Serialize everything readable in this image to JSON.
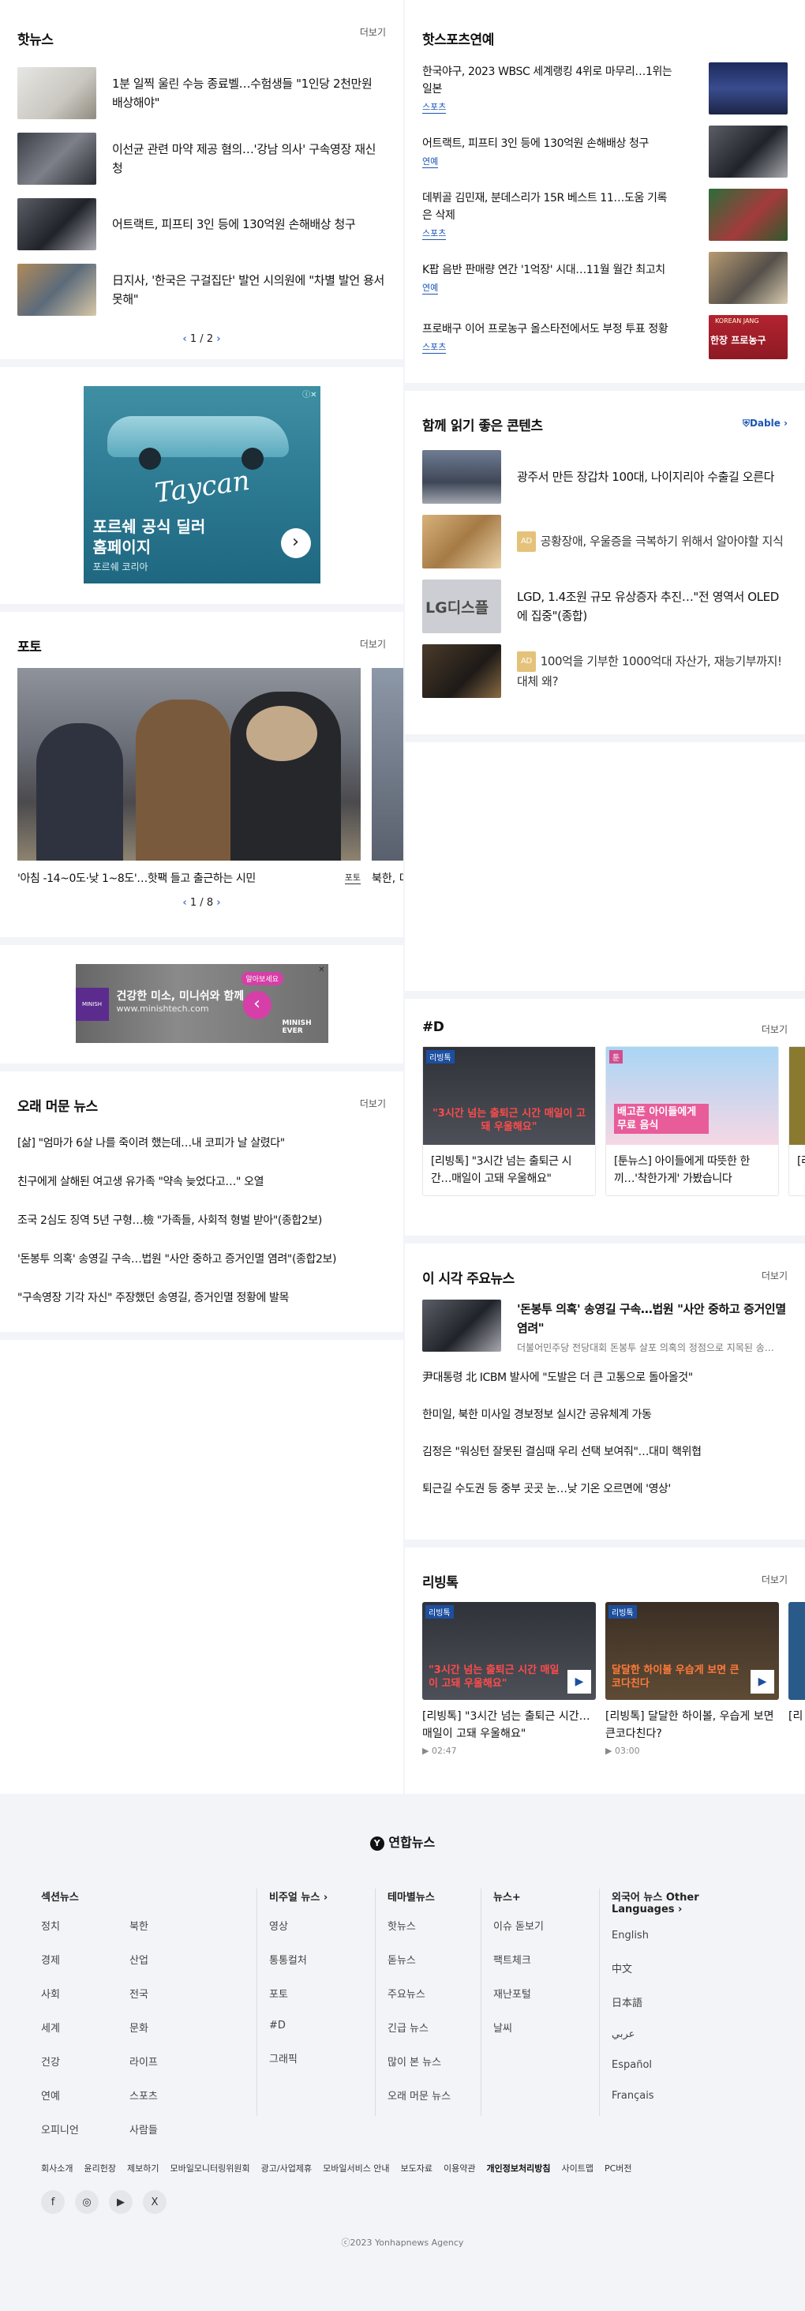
{
  "hot_news": {
    "title": "핫뉴스",
    "more": "더보기",
    "items": [
      "1분 일찍 울린 수능 종료벨…수험생들 \"1인당 2천만원 배상해야\"",
      "이선균 관련 마약 제공 혐의…'강남 의사' 구속영장 재신청",
      "어트랙트, 피프티 3인 등에 130억원 손해배상 청구",
      "日지사, '한국은 구걸집단' 발언 시의원에 \"차별 발언 용서못해\""
    ],
    "pager": "1 / 2"
  },
  "ad_porsche": {
    "line1": "포르쉐 공식 딜러",
    "line2": "홈페이지",
    "sponsor": "포르쉐 코리아",
    "car_logo": "Taycan"
  },
  "photo": {
    "title": "포토",
    "more": "더보기",
    "caption": "'아침 -14~0도·낮 1~8도'…핫팩 들고 출근하는 시민",
    "caption_more": "포토",
    "next_caption": "북한, 미",
    "pager": "1 / 8"
  },
  "ad_minish": {
    "headline": "건강한 미소, 미니쉬와 함께",
    "url": "www.minishtech.com",
    "button": "알아보세요",
    "brand": "MINISH EVER",
    "logo": "MINISH"
  },
  "long_news": {
    "title": "오래 머문 뉴스",
    "more": "더보기",
    "items": [
      "[삶] \"엄마가 6살 나를 죽이려 했는데…내 코피가 날 살렸다\"",
      "친구에게 살해된 여고생 유가족 \"약속 늦었다고…\" 오열",
      "조국 2심도 징역 5년 구형…檢 \"가족들, 사회적 형벌 받아\"(종합2보)",
      "'돈봉투 의혹' 송영길 구속…법원 \"사안 중하고 증거인멸 염려\"(종합2보)",
      "\"구속영장 기각 자신\" 주장했던 송영길, 증거인멸 정황에 발목"
    ]
  },
  "sports": {
    "title": "핫스포츠연예",
    "items": [
      {
        "text": "한국야구, 2023 WBSC 세계랭킹 4위로 마무리…1위는 일본",
        "tag": "스포츠"
      },
      {
        "text": "어트랙트, 피프티 3인 등에 130억원 손해배상 청구",
        "tag": "연예"
      },
      {
        "text": "데뷔골 김민재, 분데스리가 15R 베스트 11…도움 기록은 삭제",
        "tag": "스포츠"
      },
      {
        "text": "K팝 음반 판매량 연간 '1억장' 시대…11월 월간 최고치",
        "tag": "연예"
      },
      {
        "text": "프로배구 이어 프로농구 올스타전에서도 부정 투표 정황",
        "tag": "스포츠"
      }
    ],
    "thumb5_text": "KOREAN JANG",
    "thumb5_sub": "한장 프로농구"
  },
  "recommend": {
    "title": "함께 읽기 좋은 콘텐츠",
    "brand": "Dable",
    "ad_label": "AD",
    "items": [
      {
        "text": "광주서 만든 장갑차 100대, 나이지리아 수출길 오른다",
        "ad": false
      },
      {
        "text": "공황장애, 우울증을 극복하기 위해서 알아야할 지식",
        "ad": true
      },
      {
        "text": "LGD, 1.4조원 규모 유상증자 추진…\"전 영역서 OLED에 집중\"(종합)",
        "ad": false
      },
      {
        "text": "100억을 기부한 1000억대 자산가, 재능기부까지! 대체 왜?",
        "ad": true
      }
    ],
    "thumb3_text": "LG디스플"
  },
  "sharp_d": {
    "title": "#D",
    "more": "더보기",
    "cards": [
      {
        "badge": "리빙톡",
        "thumb_text": "\"3시간 넘는 출퇴근 시간 매일이 고돼 우울해요\"",
        "caption": "[리빙톡] \"3시간 넘는 출퇴근 시간…매일이 고돼 우울해요\""
      },
      {
        "badge": "툰",
        "thumb_text": "배고픈 아이들에게 무료 음식",
        "caption": "[툰뉴스] 아이들에게 따뜻한 한끼…'착한가게' 가봤습니다"
      }
    ],
    "next_caption": "[리"
  },
  "main_news": {
    "title": "이 시각 주요뉴스",
    "more": "더보기",
    "lead": "'돈봉투 의혹' 송영길 구속…법원 \"사안 중하고 증거인멸 염려\"",
    "lead_sub": "더불어민주당 전당대회 돈봉투 살포 의혹의 정점으로 지목된 송…",
    "items": [
      "尹대통령 北 ICBM 발사에 \"도발은 더 큰 고통으로 돌아올것\"",
      "한미일, 북한 미사일 경보정보 실시간 공유체계 가동",
      "김정은 \"워싱턴 잘못된 결심때 우리 선택 보여줘\"…대미 핵위협",
      "퇴근길 수도권 등 중부 곳곳 눈…낮 기온 오르면에 '영상'"
    ]
  },
  "living": {
    "title": "리빙톡",
    "more": "더보기",
    "badge": "리빙톡",
    "cards": [
      {
        "thumb_text": "\"3시간 넘는 출퇴근 시간 매일이 고돼 우울해요\"",
        "caption": "[리빙톡] \"3시간 넘는 출퇴근 시간…매일이 고돼 우울해요\"",
        "time": "02:47"
      },
      {
        "thumb_text": "달달한 하이볼 우습게 보면 큰코다친다",
        "caption": "[리빙톡] 달달한 하이볼, 우습게 보면 큰코다친다?",
        "time": "03:00"
      }
    ],
    "next_caption": "[리 못하"
  },
  "footer": {
    "logo": "연합뉴스",
    "sections": {
      "title": "섹션뉴스",
      "col1": [
        "정치",
        "경제",
        "사회",
        "세계",
        "건강",
        "연예",
        "오피니언"
      ],
      "col2": [
        "북한",
        "산업",
        "전국",
        "문화",
        "라이프",
        "스포츠",
        "사람들"
      ]
    },
    "visual": {
      "title": "비주얼 뉴스",
      "items": [
        "영상",
        "통통컬처",
        "포토",
        "#D",
        "그래픽"
      ]
    },
    "theme": {
      "title": "테마별뉴스",
      "items": [
        "핫뉴스",
        "돋뉴스",
        "주요뉴스",
        "긴급 뉴스",
        "많이 본 뉴스",
        "오래 머문 뉴스"
      ]
    },
    "plus": {
      "title": "뉴스+",
      "items": [
        "이슈 돋보기",
        "팩트체크",
        "재난포털",
        "날씨"
      ]
    },
    "foreign": {
      "title": "외국어 뉴스 Other Languages",
      "items": [
        "English",
        "中文",
        "日本語",
        "عربي",
        "Español",
        "Français"
      ]
    },
    "bottom_links": [
      "회사소개",
      "윤리헌장",
      "제보하기",
      "모바일모니터링위원회",
      "광고/사업제휴",
      "모바일서비스 안내",
      "보도자료",
      "이용약관",
      "개인정보처리방침",
      "사이트맵",
      "PC버전"
    ],
    "social": [
      "f",
      "◎",
      "▶",
      "X"
    ],
    "copyright": "ⓒ2023 Yonhapnews Agency"
  }
}
